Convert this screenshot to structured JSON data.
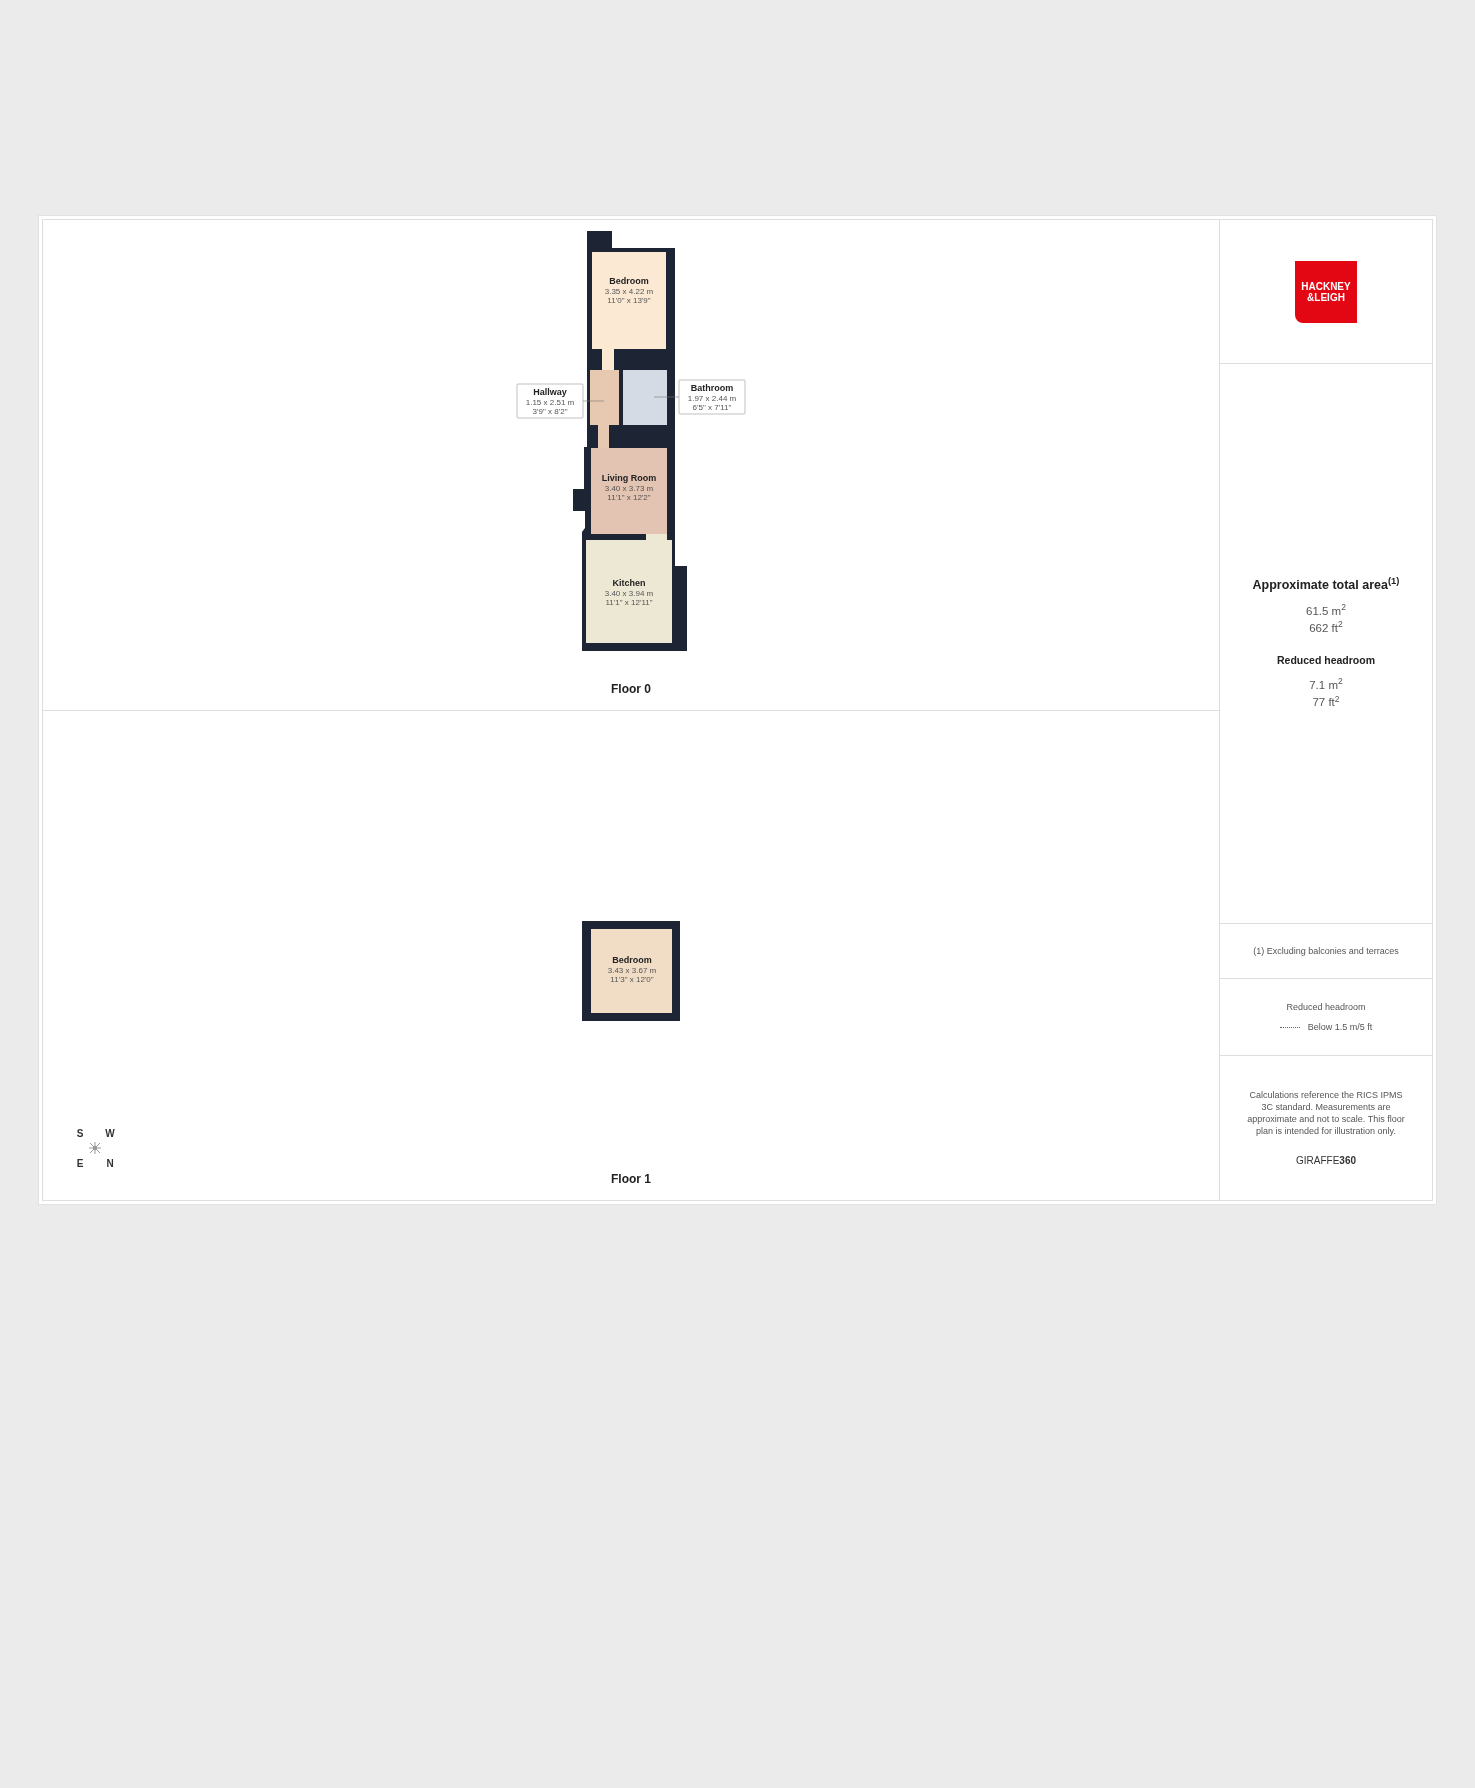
{
  "floors": [
    {
      "label": "Floor 0",
      "rooms": [
        {
          "name": "Bedroom",
          "metric": "3.35 x 4.22 m",
          "imperial": "11'0\" x 13'9\"",
          "kind": "inline"
        },
        {
          "name": "Hallway",
          "metric": "1.15 x 2.51 m",
          "imperial": "3'9\" x 8'2\"",
          "kind": "callout"
        },
        {
          "name": "Bathroom",
          "metric": "1.97 x 2.44 m",
          "imperial": "6'5\" x 7'11\"",
          "kind": "callout"
        },
        {
          "name": "Living Room",
          "metric": "3.40 x 3.73 m",
          "imperial": "11'1\" x 12'2\"",
          "kind": "inline"
        },
        {
          "name": "Kitchen",
          "metric": "3.40 x 3.94 m",
          "imperial": "11'1\" x 12'11\"",
          "kind": "inline"
        }
      ]
    },
    {
      "label": "Floor 1",
      "rooms": [
        {
          "name": "Bedroom",
          "metric": "3.43 x 3.67 m",
          "imperial": "11'3\" x 12'0\"",
          "kind": "inline"
        }
      ]
    }
  ],
  "compass": {
    "labels": [
      "S",
      "W",
      "E",
      "N"
    ]
  },
  "sidebar": {
    "logo": {
      "line_1": "HACKNEY",
      "line_2": "&LEIGH"
    },
    "total_area": {
      "title": "Approximate total area$^{(1)}$",
      "metric": "61.5 m$^{2}$",
      "imperial": "662 ft$^{2}$"
    },
    "reduced_area": {
      "title": "Reduced headroom",
      "metric": "7.1 m$^{2}$",
      "imperial": "77 ft$^{2}$"
    },
    "footnote": "(1) Excluding balconies and terraces",
    "legend": {
      "title": "Reduced headroom",
      "line_label": "Below 1.5 m/5 ft"
    },
    "disclaimer": "Calculations reference the RICS IPMS 3C standard. Measurements are approximate and not to scale. This floor plan is intended for illustration only.",
    "brand": {
      "prefix": "GIRAFFE",
      "suffix": "360"
    }
  }
}
